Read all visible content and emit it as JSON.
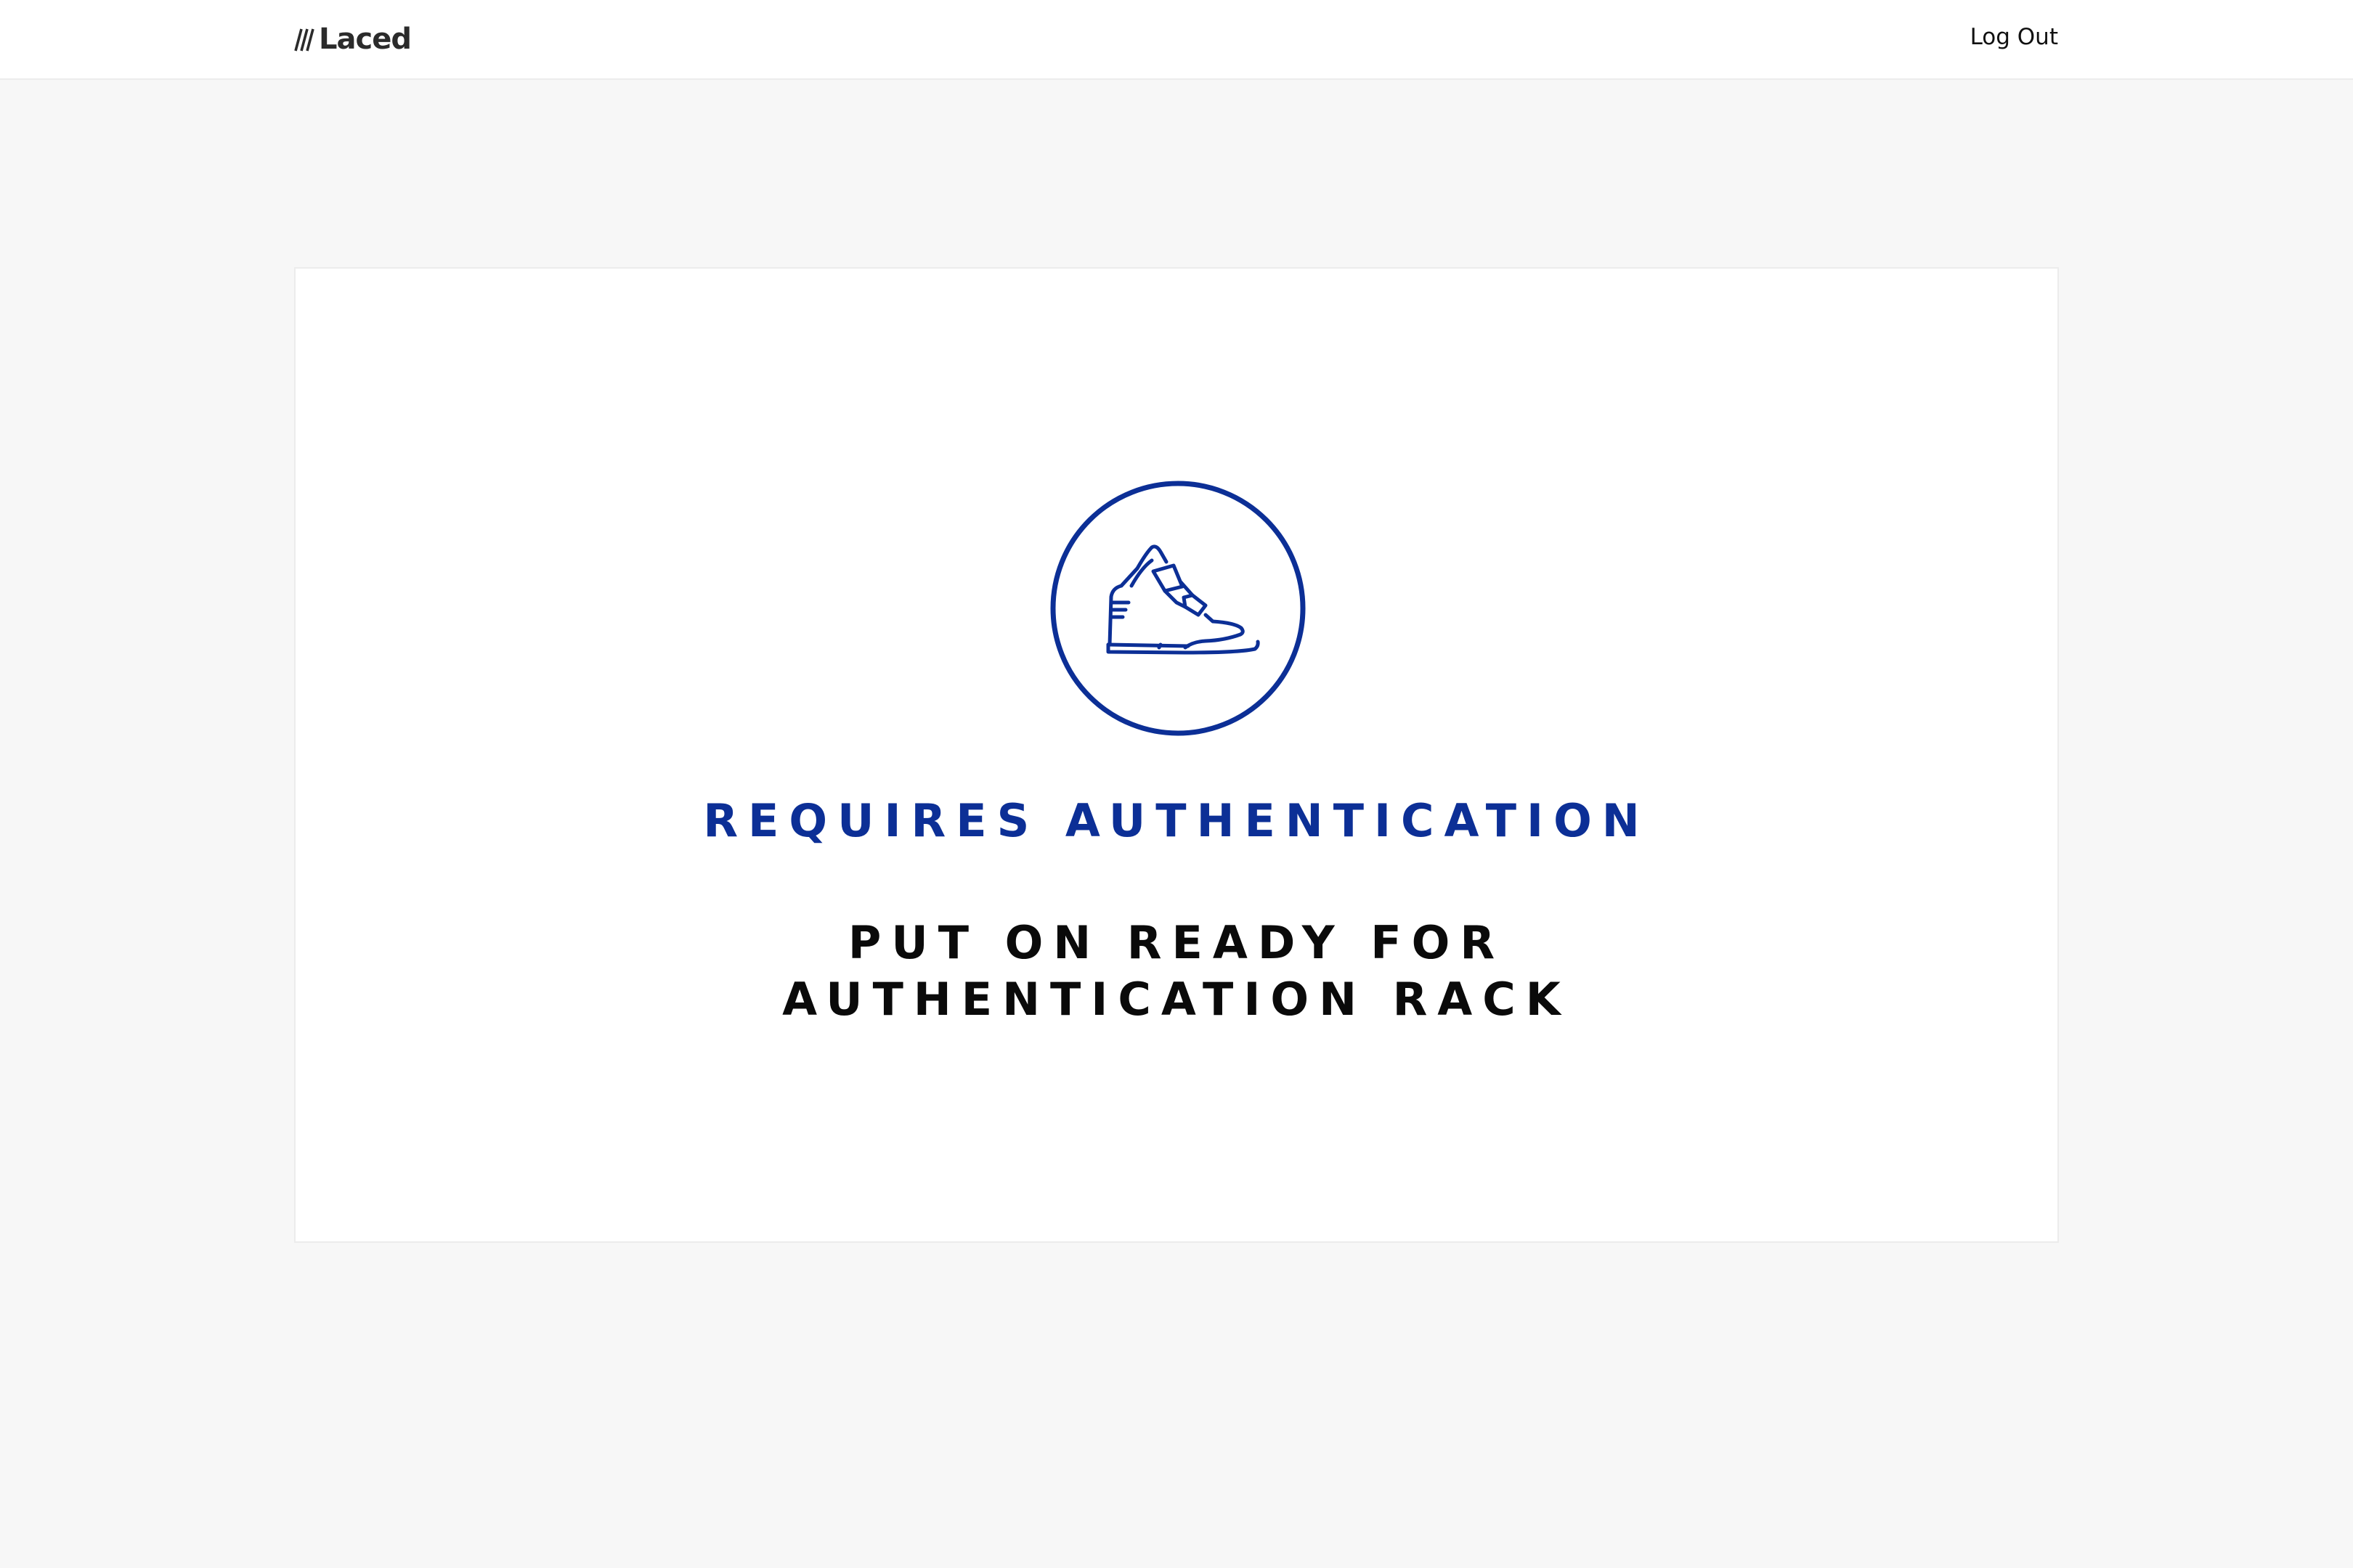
{
  "header": {
    "brand": "Laced",
    "logout_label": "Log Out"
  },
  "main": {
    "icon": "sneaker-icon",
    "status_title": "REQUIRES AUTHENTICATION",
    "instruction_lines": [
      "PUT ON READY FOR",
      "AUTHENTICATION RACK"
    ]
  },
  "colors": {
    "accent": "#0c2f96",
    "background": "#f7f7f7",
    "card": "#ffffff",
    "text": "#0a0a0a"
  }
}
